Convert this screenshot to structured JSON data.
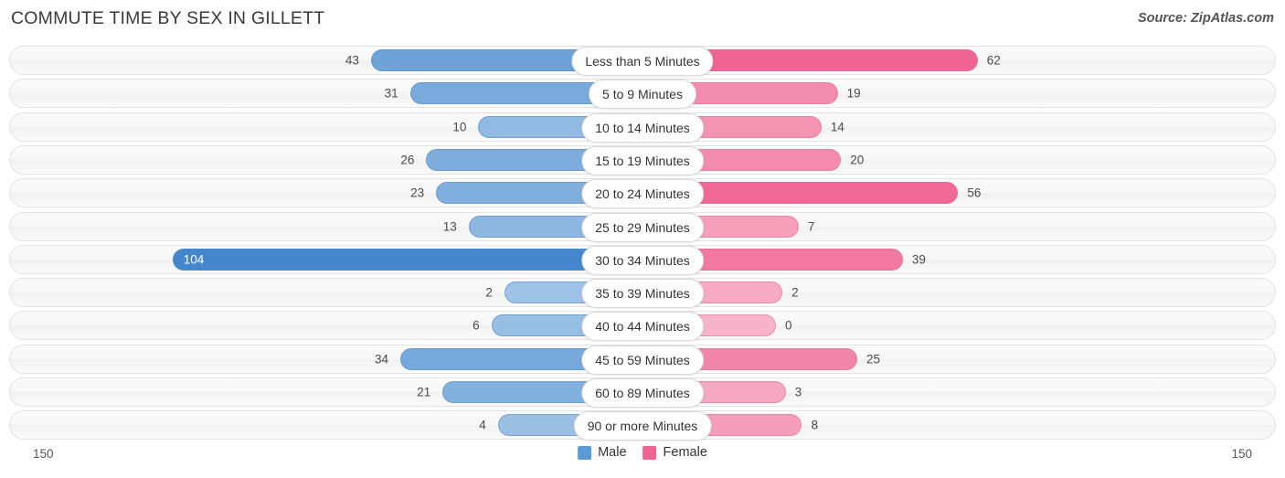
{
  "header": {
    "title": "COMMUTE TIME BY SEX IN GILLETT",
    "source": "Source: ZipAtlas.com"
  },
  "legend": {
    "male_label": "Male",
    "female_label": "Female",
    "male_color": "#5b9bd5",
    "female_color": "#f06292"
  },
  "axis": {
    "left_label": "150",
    "right_label": "150"
  },
  "chart_data": {
    "type": "bar",
    "title": "COMMUTE TIME BY SEX IN GILLETT",
    "subtitle": "",
    "xlabel": "",
    "ylabel": "",
    "orientation": "horizontal-diverging",
    "grid": false,
    "legend_position": "bottom-center",
    "axis_max": 150,
    "xlim": [
      -150,
      150
    ],
    "categories": [
      "Less than 5 Minutes",
      "5 to 9 Minutes",
      "10 to 14 Minutes",
      "15 to 19 Minutes",
      "20 to 24 Minutes",
      "25 to 29 Minutes",
      "30 to 34 Minutes",
      "35 to 39 Minutes",
      "40 to 44 Minutes",
      "45 to 59 Minutes",
      "60 to 89 Minutes",
      "90 or more Minutes"
    ],
    "series": [
      {
        "name": "Male",
        "color": "#5b9bd5",
        "direction": "left",
        "values": [
          43,
          31,
          10,
          26,
          23,
          13,
          104,
          2,
          6,
          34,
          21,
          4
        ]
      },
      {
        "name": "Female",
        "color": "#f06292",
        "direction": "right",
        "values": [
          62,
          19,
          14,
          20,
          56,
          7,
          39,
          2,
          0,
          25,
          3,
          8
        ]
      }
    ]
  }
}
